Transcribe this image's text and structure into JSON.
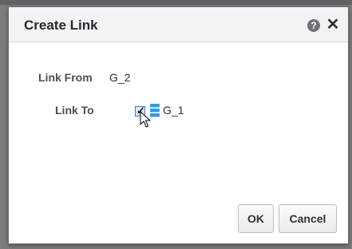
{
  "dialog": {
    "title": "Create Link",
    "help_icon": "help-icon",
    "help_glyph": "?",
    "close_icon": "close-icon",
    "close_glyph": "✕"
  },
  "form": {
    "link_from_label": "Link From",
    "link_from_value": "G_2",
    "link_to_label": "Link To",
    "link_to_item": {
      "checked": true,
      "check_glyph": "✓",
      "icon": "database-icon",
      "label": "G_1"
    }
  },
  "buttons": {
    "ok_label": "OK",
    "cancel_label": "Cancel"
  },
  "colors": {
    "accent": "#3f79c2",
    "database_icon": "#2f9ae0"
  }
}
